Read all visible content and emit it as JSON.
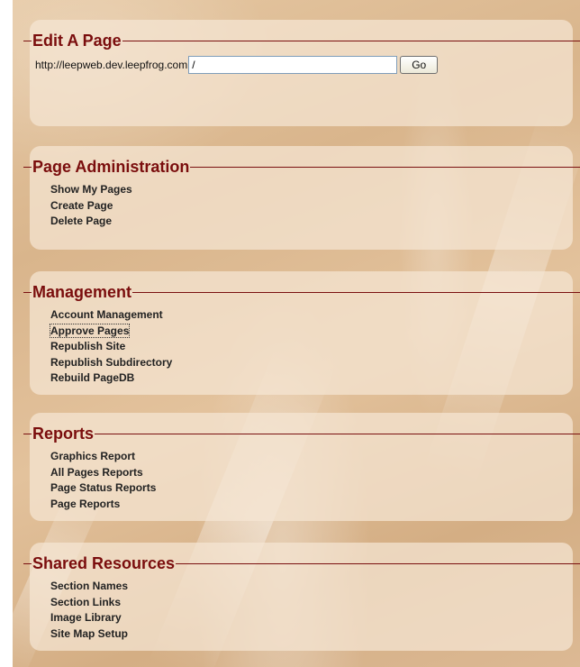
{
  "edit_page": {
    "title": "Edit A Page",
    "url_prefix": "http://leepweb.dev.leepfrog.com",
    "url_value": "/",
    "go_label": "Go"
  },
  "page_administration": {
    "title": "Page Administration",
    "links": [
      "Show My Pages",
      "Create Page",
      "Delete Page"
    ]
  },
  "management": {
    "title": "Management",
    "links": [
      "Account Management",
      "Approve Pages",
      "Republish Site",
      "Republish Subdirectory",
      "Rebuild PageDB"
    ]
  },
  "reports": {
    "title": "Reports",
    "links": [
      "Graphics Report",
      "All Pages Reports",
      "Page Status Reports",
      "Page Reports"
    ]
  },
  "shared_resources": {
    "title": "Shared Resources",
    "links": [
      "Section Names",
      "Section Links",
      "Image Library",
      "Site Map Setup"
    ]
  },
  "colors": {
    "heading": "#7a0d0d",
    "rule": "#7a1010",
    "link_text": "#222222"
  }
}
